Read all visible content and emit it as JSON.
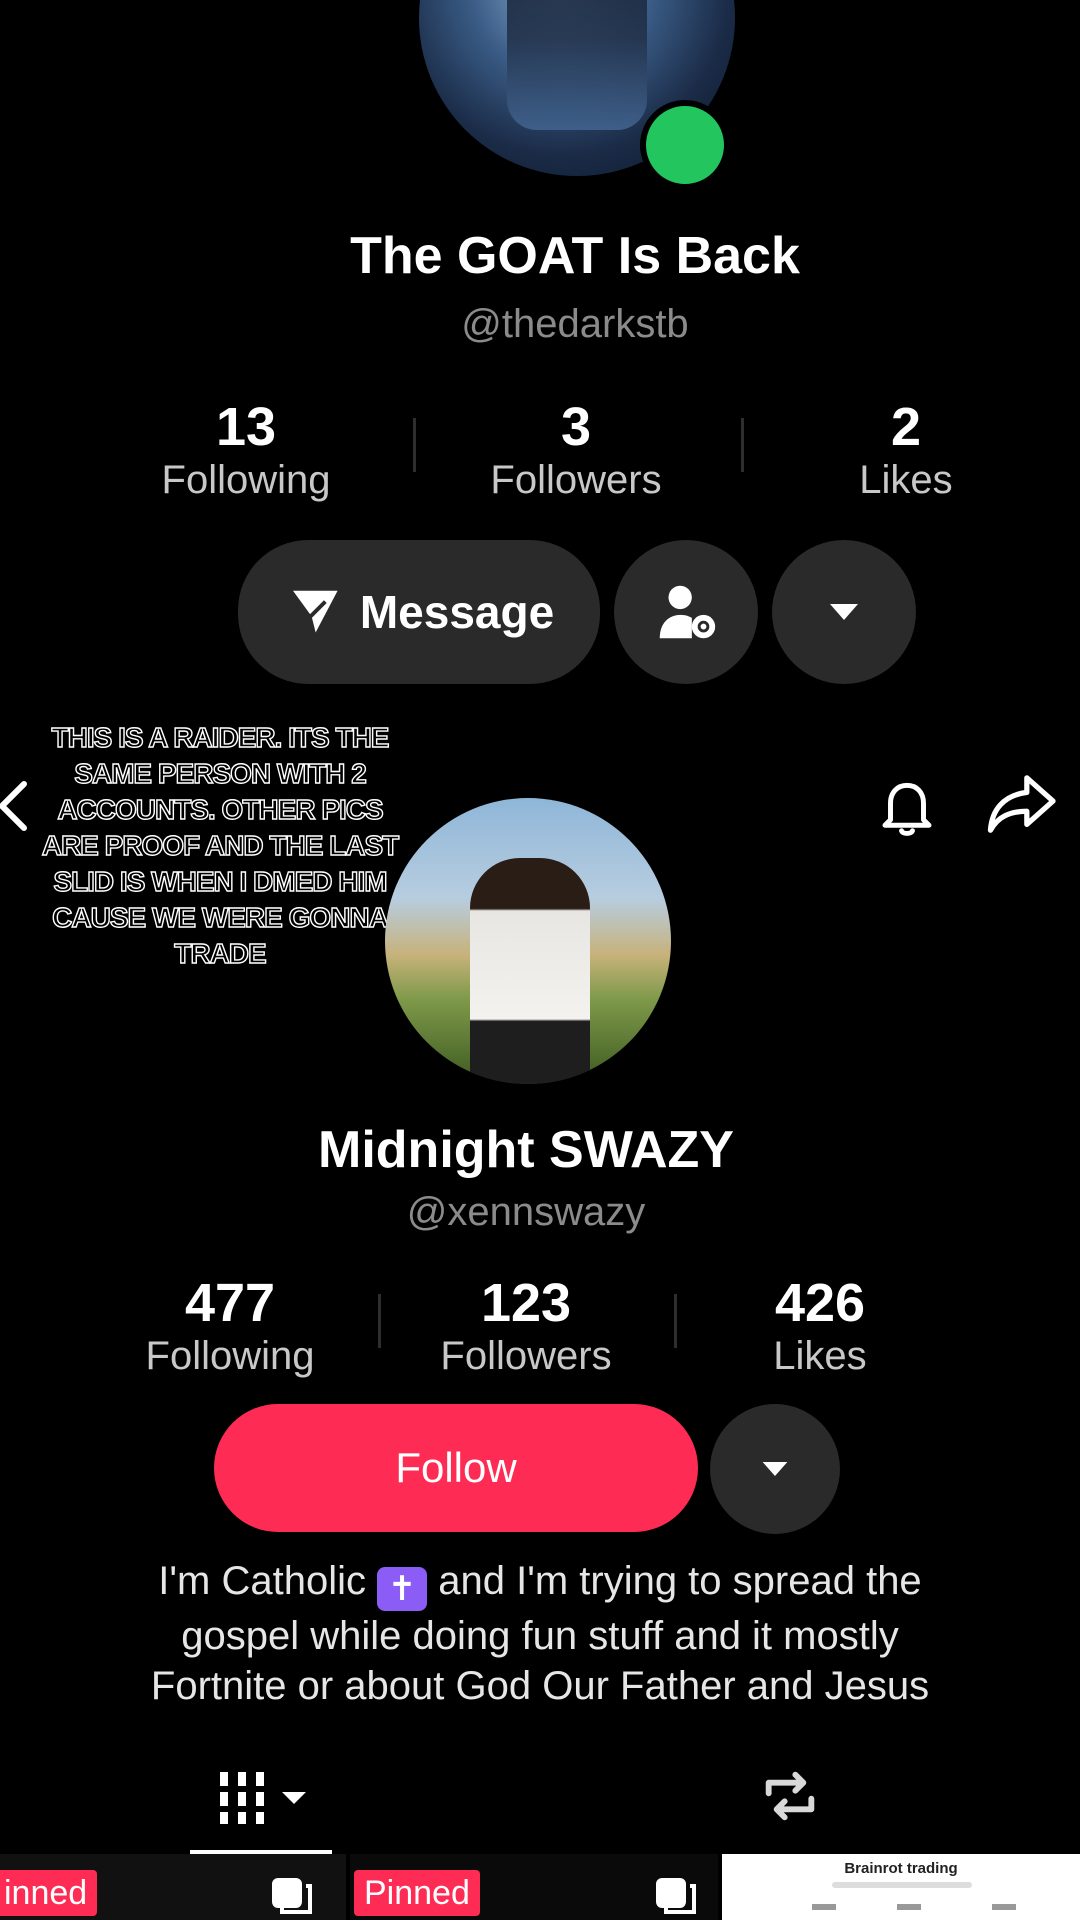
{
  "top_profile": {
    "display_name": "The GOAT Is Back",
    "handle": "@thedarkstb",
    "stats": [
      {
        "value": "13",
        "label": "Following"
      },
      {
        "value": "3",
        "label": "Followers"
      },
      {
        "value": "2",
        "label": "Likes"
      }
    ],
    "message_label": "Message",
    "online_color": "#22c55e"
  },
  "caption": "THIS IS A RAIDER. ITS THE SAME PERSON WITH 2 ACCOUNTS. OTHER PICS ARE PROOF AND THE LAST SLID IS WHEN I DMED HIM CAUSE WE WERE GONNA TRADE",
  "bottom_profile": {
    "display_name": "Midnight SWAZY",
    "handle": "@xennswazy",
    "stats": [
      {
        "value": "477",
        "label": "Following"
      },
      {
        "value": "123",
        "label": "Followers"
      },
      {
        "value": "426",
        "label": "Likes"
      }
    ],
    "follow_label": "Follow",
    "follow_color": "#fe2c55",
    "bio_lines": [
      [
        "I'm Catholic ",
        "✝",
        " and I'm trying to spread the"
      ],
      "gospel while doing fun stuff and it mostly",
      "Fortnite or about God Our Father and Jesus"
    ]
  },
  "grid": {
    "pinned_label": "Pinned",
    "pinned_label_cropped": "inned",
    "third_thumb_title": "Brainrot trading"
  }
}
